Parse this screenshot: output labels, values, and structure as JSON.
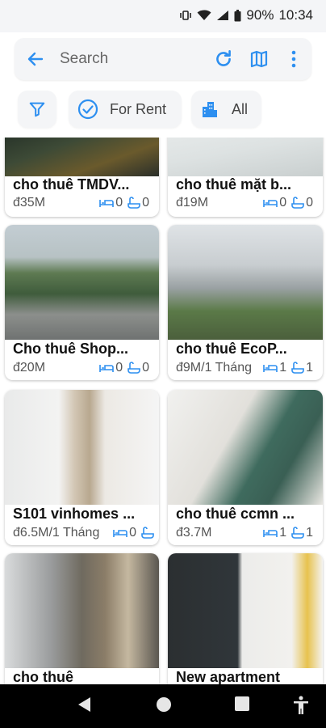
{
  "status": {
    "battery": "90%",
    "time": "10:34"
  },
  "search": {
    "placeholder": "Search"
  },
  "filters": {
    "rent_label": "For Rent",
    "type_label": "All"
  },
  "colors": {
    "accent": "#2d8ff0",
    "chip_bg": "#f4f5f7"
  },
  "listings": [
    {
      "title": "cho thuê TMDV...",
      "price": "đ35M",
      "beds": "0",
      "baths": "0"
    },
    {
      "title": "cho thuê mặt b...",
      "price": "đ19M",
      "beds": "0",
      "baths": "0"
    },
    {
      "title": "Cho thuê Shop...",
      "price": "đ20M",
      "beds": "0",
      "baths": "0"
    },
    {
      "title": "cho thuê EcoP...",
      "price": "đ9M/1 Tháng",
      "beds": "1",
      "baths": "1"
    },
    {
      "title": "S101 vinhomes ...",
      "price": "đ6.5M/1 Tháng",
      "beds": "0",
      "baths": ""
    },
    {
      "title": "cho thuê ccmn ...",
      "price": "đ3.7M",
      "beds": "1",
      "baths": "1"
    },
    {
      "title": "cho thuê",
      "price": "",
      "beds": "",
      "baths": ""
    },
    {
      "title": "New apartment",
      "price": "",
      "beds": "",
      "baths": ""
    }
  ],
  "icons": [
    "back-arrow-icon",
    "refresh-icon",
    "map-icon",
    "more-vert-icon",
    "filter-icon",
    "check-circle-icon",
    "building-icon",
    "bed-icon",
    "bath-icon"
  ]
}
